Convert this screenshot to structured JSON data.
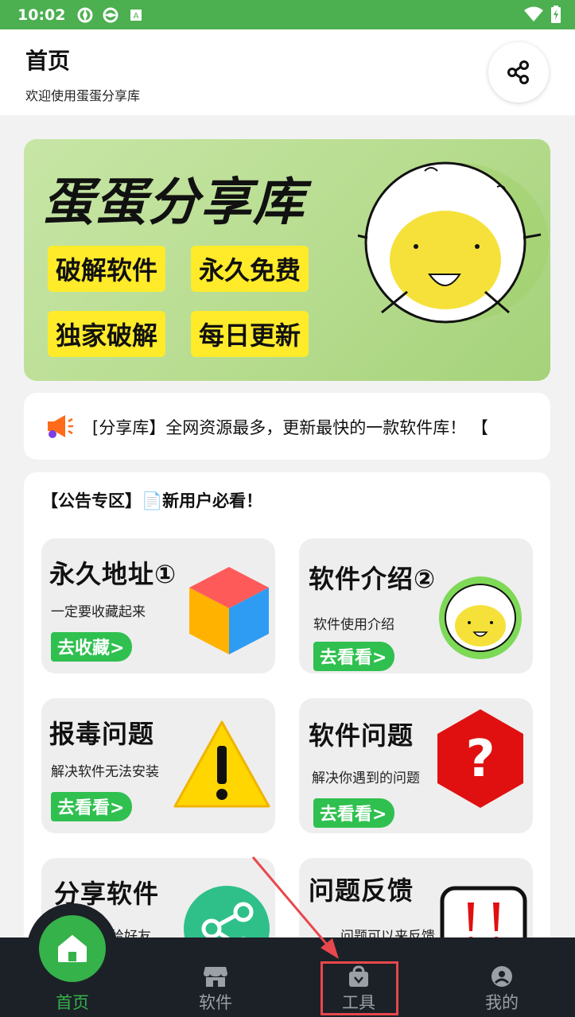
{
  "status_bar": {
    "time": "10:02"
  },
  "header": {
    "title": "首页",
    "subtitle": "欢迎使用蛋蛋分享库"
  },
  "banner": {
    "title": "蛋蛋分享库",
    "tags": [
      "破解软件",
      "永久免费",
      "独家破解",
      "每日更新"
    ]
  },
  "marquee": {
    "text": "[分享库】全网资源最多，更新最快的一款软件库！ 【"
  },
  "notice": {
    "title": "【公告专区】📄新用户必看！",
    "cards": [
      {
        "title": "永久地址①",
        "desc": "一定要收藏起来",
        "button": "去收藏>"
      },
      {
        "title": "软件介绍②",
        "desc": "软件使用介绍",
        "button": "去看看>"
      },
      {
        "title": "报毒问题",
        "desc": "解决软件无法安装",
        "button": "去看看>"
      },
      {
        "title": "软件问题",
        "desc": "解决你遇到的问题",
        "button": "去看看>"
      },
      {
        "title": "分享软件",
        "desc": "享给好友"
      },
      {
        "title": "问题反馈",
        "desc": "问题可以来反馈"
      }
    ]
  },
  "nav": {
    "items": [
      {
        "label": "首页",
        "icon": "home-icon",
        "active": true
      },
      {
        "label": "软件",
        "icon": "store-icon"
      },
      {
        "label": "工具",
        "icon": "bag-icon"
      },
      {
        "label": "我的",
        "icon": "user-icon"
      }
    ]
  },
  "colors": {
    "status_bar": "#4caf50",
    "accent_green": "#35b24a",
    "nav_bg": "#1c2128",
    "tag_yellow": "#ffeb2a",
    "highlight": "#e8474c"
  }
}
